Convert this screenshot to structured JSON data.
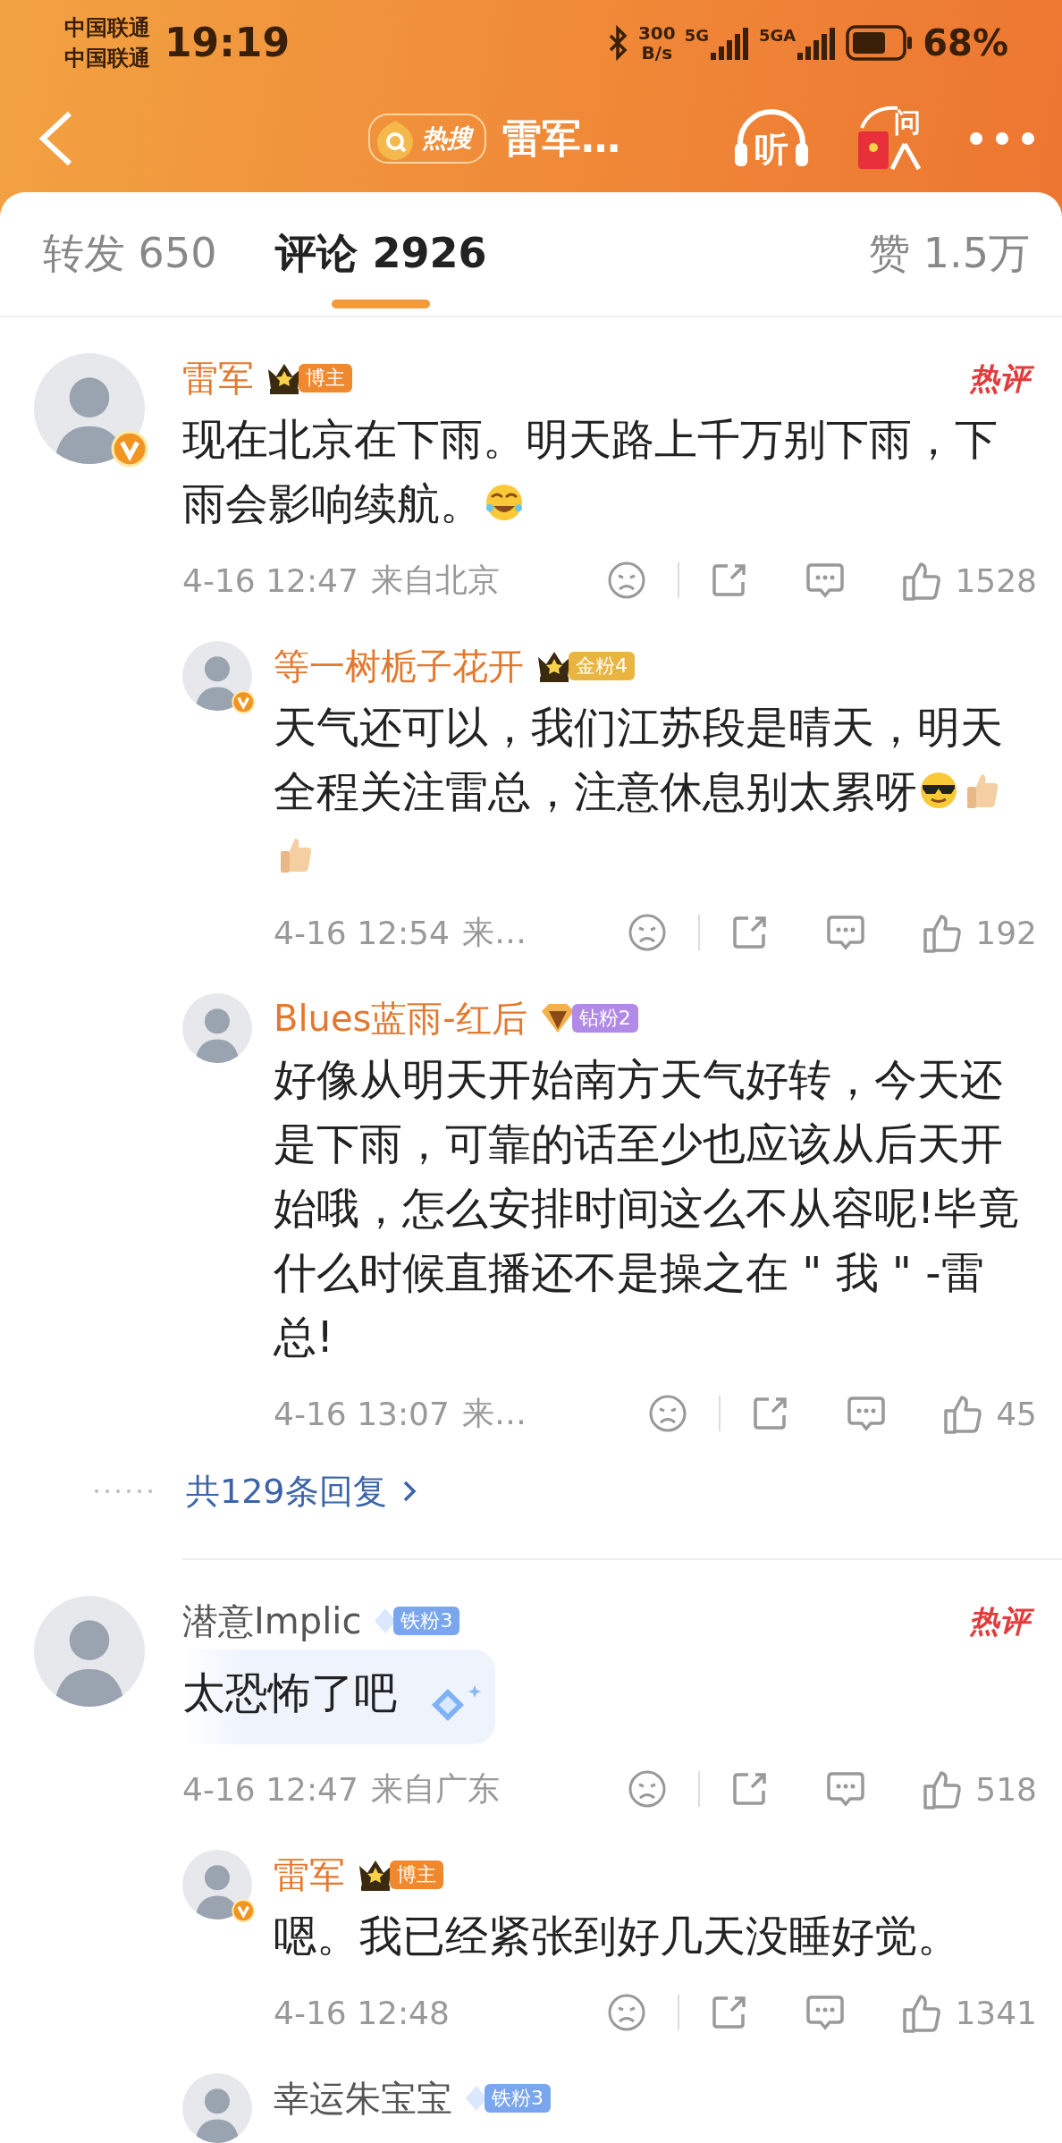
{
  "status_bar": {
    "carriers": [
      "中国联通",
      "中国联通"
    ],
    "time": "19:19",
    "speed": [
      "300",
      "B/s"
    ],
    "networks": [
      "5G",
      "5GA"
    ],
    "battery": "68%"
  },
  "header": {
    "hot_label": "热搜",
    "title": "雷军…",
    "listen_label": "听",
    "ask_label": "问"
  },
  "tabs": [
    {
      "label": "转发 650",
      "selected": false
    },
    {
      "label": "评论 2926",
      "selected": true
    }
  ],
  "likes_total": "赞 1.5万",
  "comments": [
    {
      "name": "雷军",
      "vip": true,
      "verified": true,
      "badge": {
        "kind": "crown",
        "label": "博主",
        "color": "#f0892e"
      },
      "hot_label": "热评",
      "text": "现在北京在下雨。明天路上千万别下雨，下雨会影响续航。",
      "emojis": [
        {
          "kind": "laugh"
        }
      ],
      "time": "4-16 12:47",
      "location": "来自北京",
      "likes": "1528",
      "more_replies": "共129条回复",
      "replies": [
        {
          "name": "等一树栀子花开",
          "vip": true,
          "verified": true,
          "badge": {
            "kind": "crown",
            "label": "金粉4",
            "color": "#e9b540"
          },
          "text": "天气还可以，我们江苏段是晴天，明天全程关注雷总，注意休息别太累呀",
          "emojis": [
            {
              "kind": "cool"
            },
            {
              "kind": "thumbs"
            },
            {
              "kind": "thumbs"
            }
          ],
          "time": "4-16 12:54",
          "location": "来…",
          "likes": "192"
        },
        {
          "name": "Blues蓝雨-红后",
          "vip": true,
          "verified": false,
          "badge": {
            "kind": "gem",
            "label": "钻粉2",
            "color": "#b189e6"
          },
          "text": "好像从明天开始南方天气好转，今天还是下雨，可靠的话至少也应该从后天开始哦，怎么安排时间这么不从容呢!毕竟什么时候直播还不是操之在 \" 我 \" -雷总!",
          "time": "4-16 13:07",
          "location": "来…",
          "likes": "45"
        }
      ]
    },
    {
      "name": "潜意Implic",
      "vip": false,
      "verified": false,
      "badge": {
        "kind": "diamond",
        "label": "铁粉3",
        "color": "#79a6ec"
      },
      "hot_label": "热评",
      "bubble": true,
      "text": "太恐怖了吧",
      "time": "4-16 12:47",
      "location": "来自广东",
      "likes": "518",
      "replies": [
        {
          "name": "雷军",
          "vip": true,
          "verified": true,
          "badge": {
            "kind": "crown",
            "label": "博主",
            "color": "#f0892e"
          },
          "text": "嗯。我已经紧张到好几天没睡好觉。",
          "time": "4-16 12:48",
          "likes": "1341"
        },
        {
          "name": "幸运朱宝宝",
          "vip": false,
          "verified": false,
          "badge": {
            "kind": "diamond",
            "label": "铁粉3",
            "color": "#79a6ec"
          }
        }
      ]
    }
  ]
}
